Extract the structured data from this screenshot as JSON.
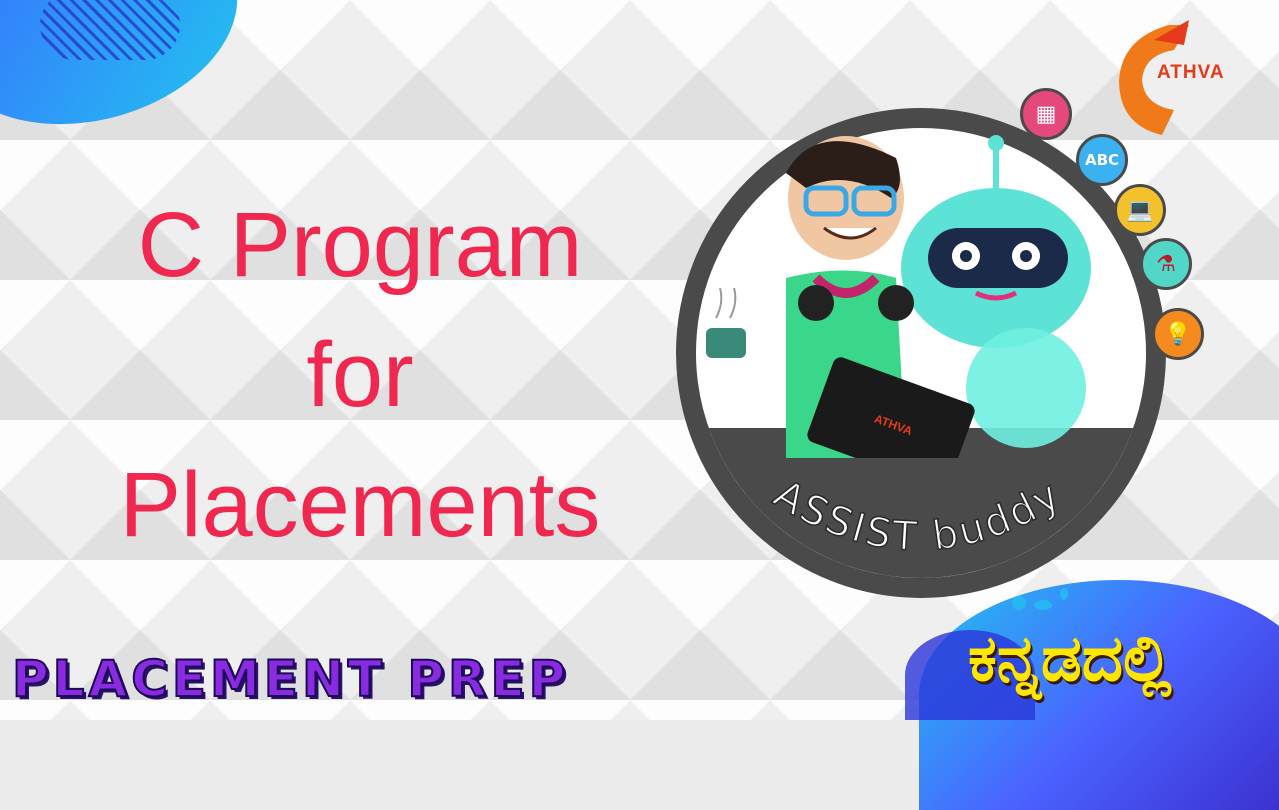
{
  "title": {
    "line1": "C Program",
    "line2": "for",
    "line3": "Placements"
  },
  "subtitle": "PLACEMENT PREP",
  "kannada_tag": "ಕನ್ನಡದಲ್ಲಿ",
  "brand": {
    "logo_text": "ATHVA",
    "badge_text": "ASSIST buddy",
    "laptop_logo_text": "ATHVA"
  },
  "icons": [
    {
      "name": "puzzle-icon",
      "glyph": "▦"
    },
    {
      "name": "abc-blocks-icon",
      "glyph": "ABC"
    },
    {
      "name": "laptop-icon",
      "glyph": "💻"
    },
    {
      "name": "flask-icon",
      "glyph": "⚗"
    },
    {
      "name": "lightbulb-icon",
      "glyph": "💡"
    }
  ],
  "colors": {
    "title": "#f0274f",
    "subtitle": "#8a2be2",
    "kannada": "#ffe600",
    "brand_orange": "#e53a1b",
    "ring": "#4a4a4a"
  }
}
